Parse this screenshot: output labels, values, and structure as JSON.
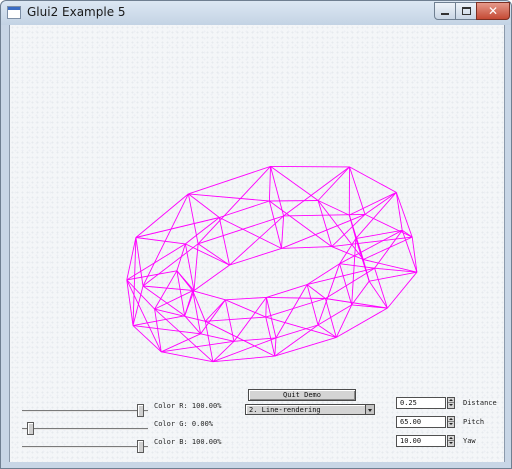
{
  "window": {
    "title": "Glui2 Example 5",
    "close_glyph": "✕"
  },
  "controls": {
    "quit_button": "Quit Demo",
    "render_mode": "2. Line-rendering",
    "sliders": [
      {
        "label": "Color R: 100.00%",
        "value": 1.0
      },
      {
        "label": "Color G: 0.00%",
        "value": 0.0
      },
      {
        "label": "Color B: 100.00%",
        "value": 1.0
      }
    ],
    "spinners": [
      {
        "value": "0.25",
        "label": "Distance"
      },
      {
        "value": "65.00",
        "label": "Pitch"
      },
      {
        "value": "10.00",
        "label": "Yaw"
      }
    ]
  },
  "scene": {
    "torus_color": "#ff00ff",
    "major_segments": 12,
    "minor_segments": 4
  }
}
